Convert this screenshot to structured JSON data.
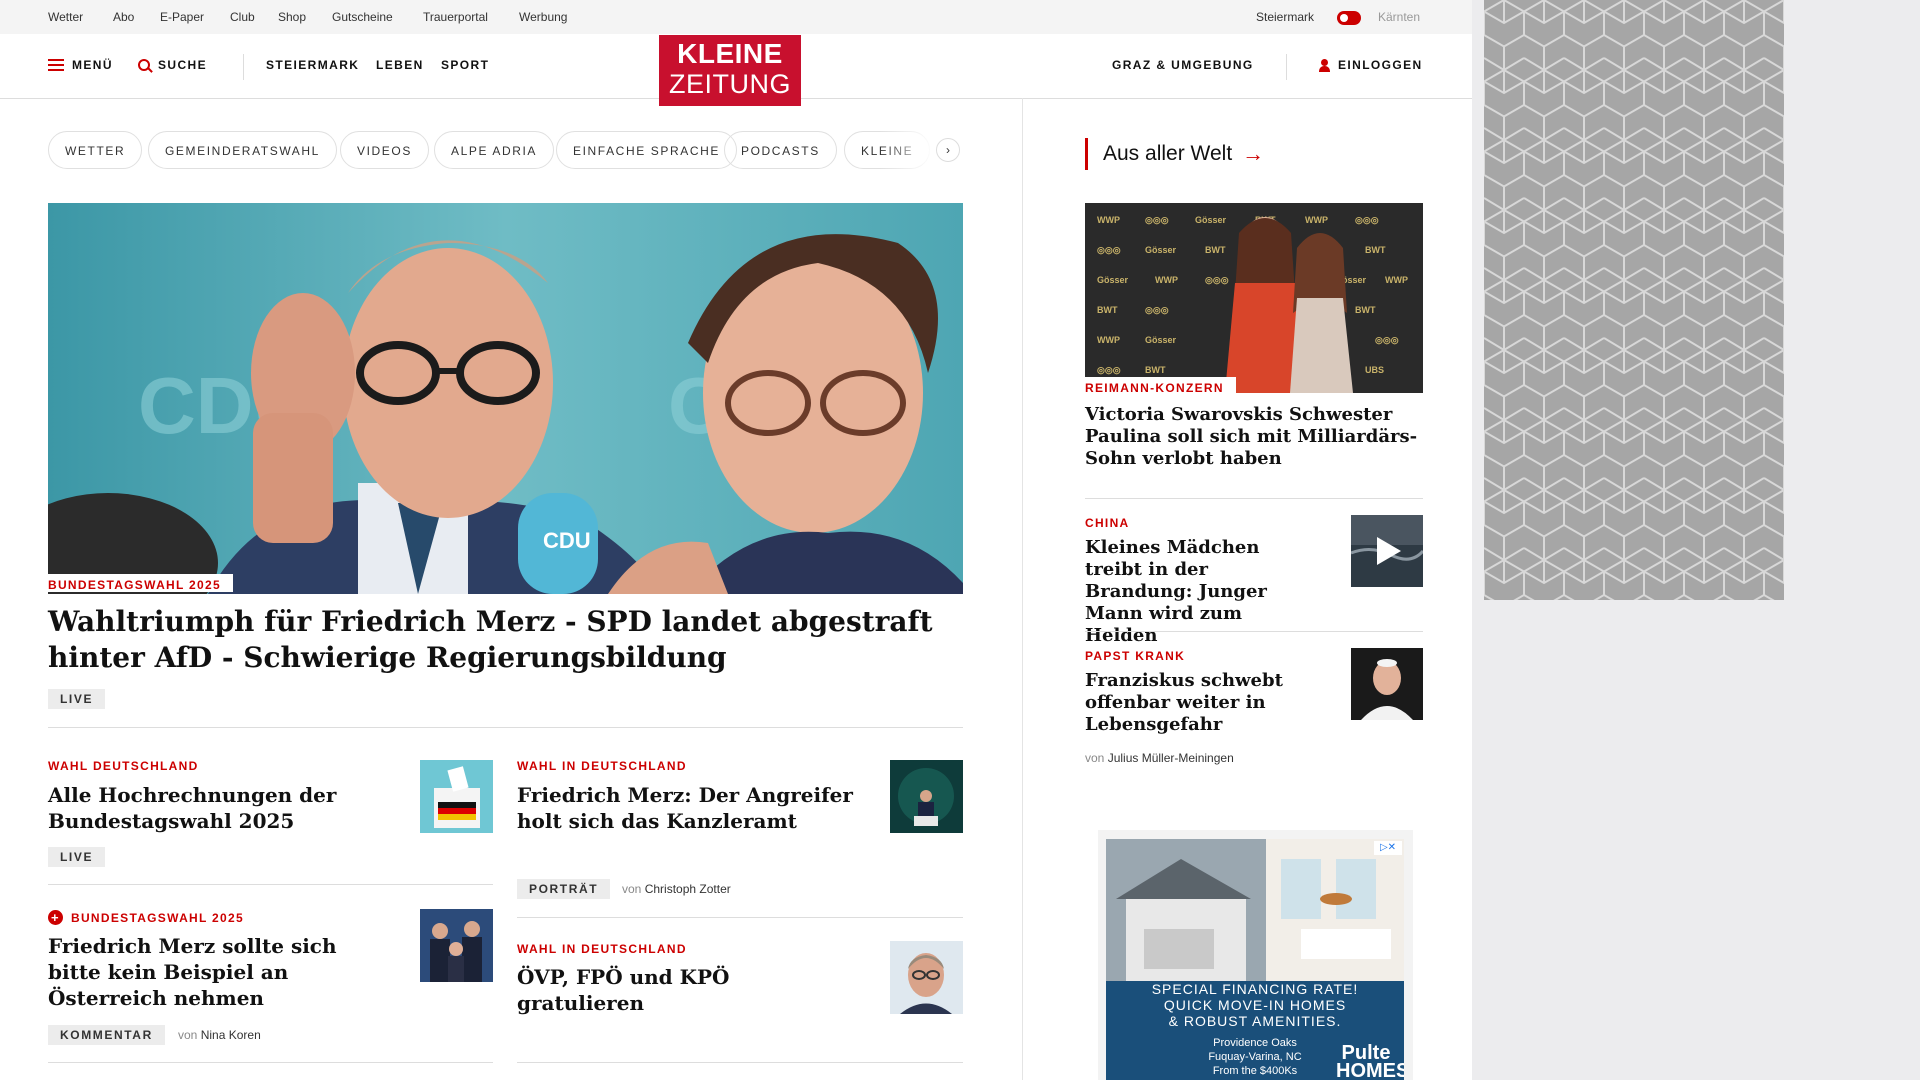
{
  "utility_nav": {
    "links": [
      "Wetter",
      "Abo",
      "E-Paper",
      "Club",
      "Shop",
      "Gutscheine",
      "Trauerportal",
      "Werbung"
    ],
    "region_left": "Steiermark",
    "region_right": "Kärnten"
  },
  "main_nav": {
    "menu": "MENÜ",
    "search": "SUCHE",
    "sections": [
      "STEIERMARK",
      "LEBEN",
      "SPORT"
    ],
    "region": "GRAZ & UMGEBUNG",
    "login": "EINLOGGEN"
  },
  "logo": {
    "line1": "KLEINE",
    "line2": "ZEITUNG",
    "color": "#c8102e"
  },
  "topic_pills": [
    "WETTER",
    "GEMEINDERATSWAHL",
    "VIDEOS",
    "ALPE ADRIA",
    "EINFACHE SPRACHE",
    "PODCASTS",
    "KLEINE"
  ],
  "pill_next": "›",
  "hero": {
    "kicker": "BUNDESTAGSWAHL 2025",
    "headline": "Wahltriumph für Friedrich Merz - SPD landet abgestraft hinter AfD - Schwierige Regierungsbildung",
    "badge": "LIVE",
    "image_text": "CDU"
  },
  "articles": [
    {
      "kicker": "WAHL DEUTSCHLAND",
      "headline": "Alle Hochrechnungen der Bundestagswahl 2025",
      "badge": "LIVE",
      "thumb": "ballot-box"
    },
    {
      "kicker": "WAHL IN DEUTSCHLAND",
      "headline": "Friedrich Merz: Der Angreifer holt sich das Kanzleramt",
      "badge": "PORTRÄT",
      "author_prefix": "von",
      "author": "Christoph Zotter",
      "thumb": "speaker-stage"
    },
    {
      "kicker": "BUNDESTAGSWAHL 2025",
      "headline": "Friedrich Merz sollte sich bitte kein Beispiel an Österreich nehmen",
      "badge": "KOMMENTAR",
      "author_prefix": "von",
      "author": "Nina Koren",
      "premium": true,
      "thumb": "politicians"
    },
    {
      "kicker": "WAHL IN DEUTSCHLAND",
      "headline": "ÖVP, FPÖ und KPÖ gratulieren",
      "thumb": "portrait"
    }
  ],
  "sidebar": {
    "title": "Aus aller Welt",
    "arrow": "→",
    "feature": {
      "kicker": "REIMANN-KONZERN",
      "headline": "Victoria Swarovskis Schwester Paulina soll sich mit Milliardärs-Sohn verlobt haben"
    },
    "items": [
      {
        "kicker": "CHINA",
        "headline": "Kleines Mädchen treibt in der Brandung: Junger Mann wird zum Helden",
        "video": true
      },
      {
        "kicker": "PAPST KRANK",
        "headline": "Franziskus schwebt offenbar weiter in Lebensgefahr",
        "author_prefix": "von",
        "author": "Julius Müller-Meiningen"
      }
    ]
  },
  "ad": {
    "line1": "SPECIAL FINANCING RATE!",
    "line2": "QUICK MOVE-IN HOMES",
    "line3": "& ROBUST AMENITIES.",
    "location1": "Providence Oaks",
    "location2": "Fuquay-Varina, NC",
    "price": "From the $400Ks",
    "brand": "Pulte HOMES"
  },
  "colors": {
    "accent": "#c00",
    "brand": "#c8102e"
  }
}
